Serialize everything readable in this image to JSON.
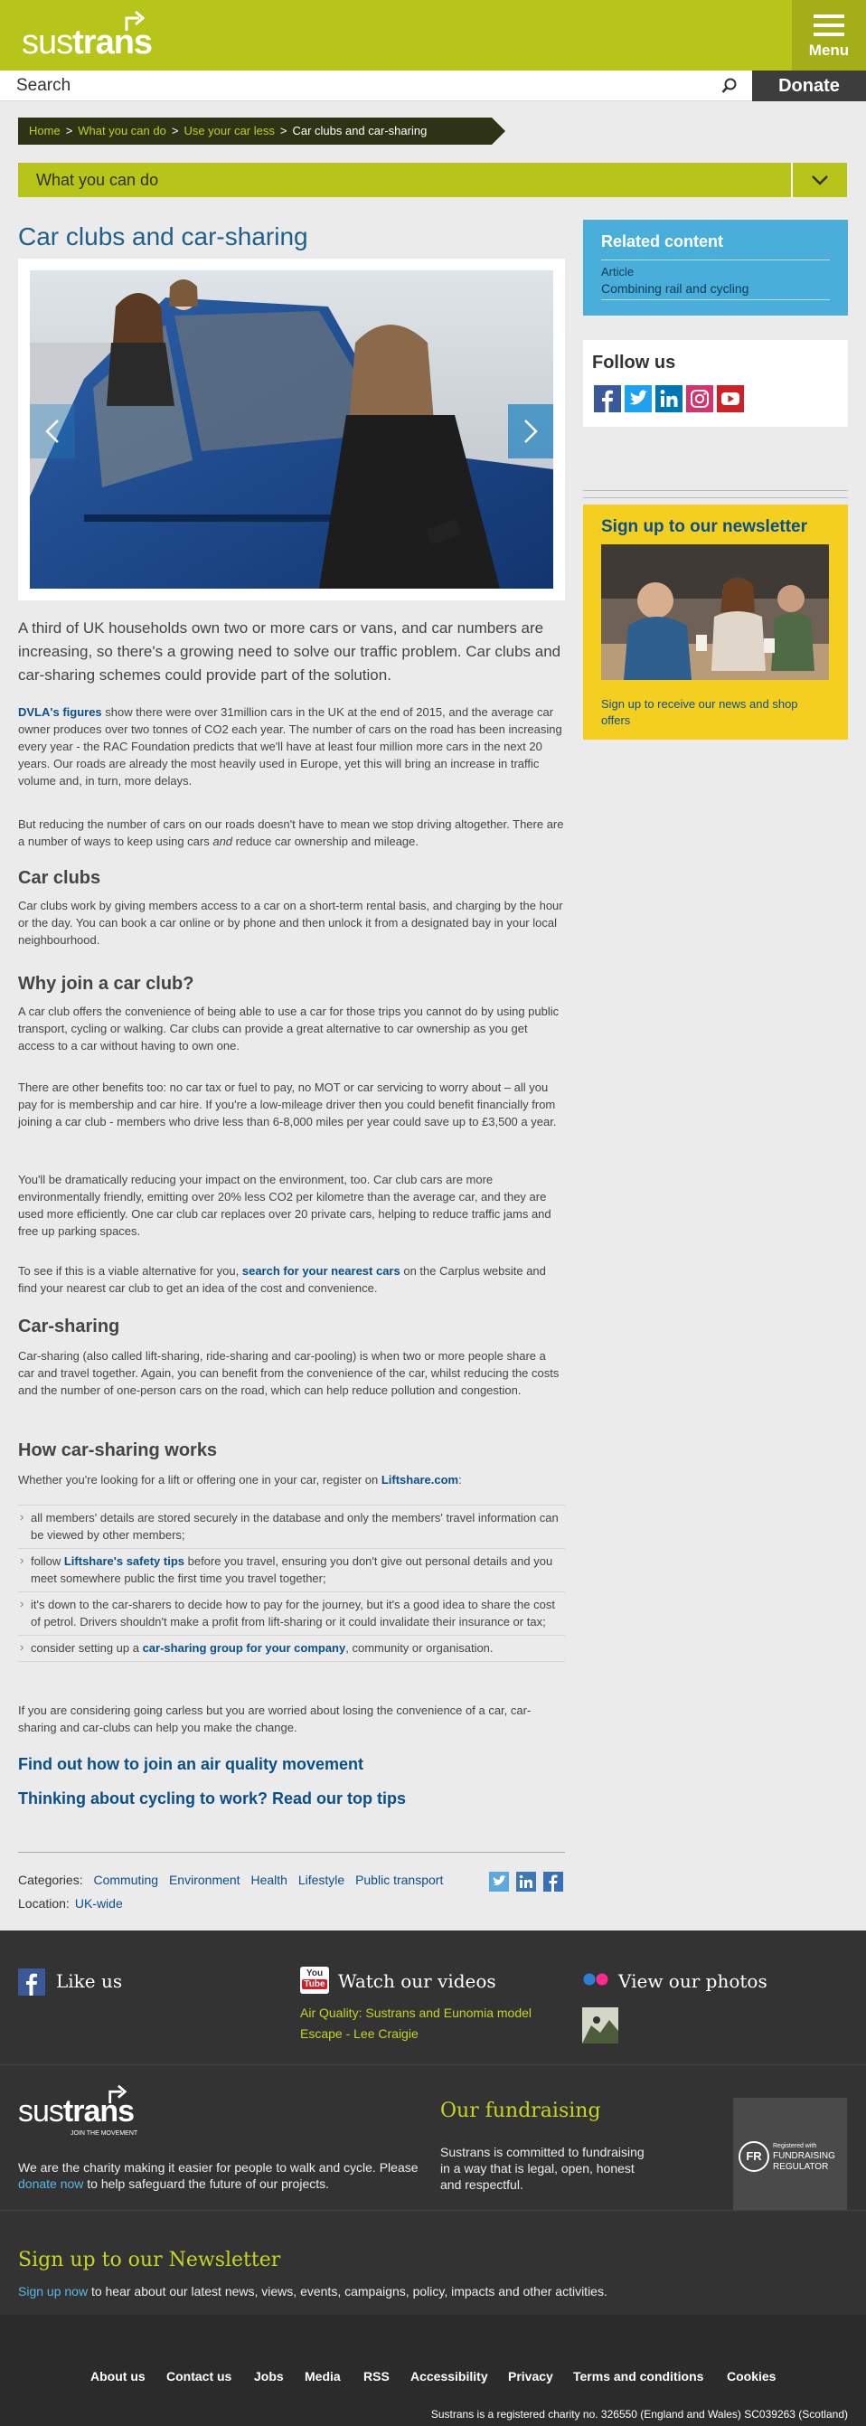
{
  "header": {
    "logo_part1": "sus",
    "logo_part2": "trans",
    "menu_label": "Menu",
    "search_placeholder": "Search",
    "donate_label": "Donate"
  },
  "breadcrumb": {
    "items": [
      "Home",
      "What you can do",
      "Use your car less"
    ],
    "separator": ">",
    "current": "Car clubs and car-sharing"
  },
  "section_nav": {
    "label": "What you can do"
  },
  "article": {
    "title": "Car clubs and car-sharing",
    "lead": "A third of UK households own two or more cars or vans, and car numbers are increasing, so there's a growing need to solve our traffic problem. Car clubs and car-sharing schemes could provide part of the solution.",
    "p1_link": "DVLA's figures",
    "p1_text": " show there were over 31million cars in the UK at the end of 2015, and the average car owner produces over two tonnes of CO2 each year. The number of cars on the road has been increasing every year - the RAC Foundation predicts that we'll have at least four million more cars in the next 20 years. Our roads are already the most heavily used in Europe, yet this will bring an increase in traffic volume and, in turn, more delays.",
    "p2_a": "But reducing the number of cars on our roads doesn't have to mean we stop driving altogether. There are a number of ways to keep using cars ",
    "p2_em": "and",
    "p2_b": " reduce car ownership and mileage.",
    "h_car_clubs": "Car clubs",
    "p3": "Car clubs work by giving members access to a car on a short-term rental basis, and charging by the hour or the day. You can book a car online or by phone and then unlock it from a designated bay in your local neighbourhood.",
    "h_why": "Why join a car club?",
    "p4": "A car club offers the convenience of being able to use a car for those trips you cannot do by using public transport, cycling or walking. Car clubs can provide a great alternative to car ownership as you get access to a car without having to own one.",
    "p5": "There are other benefits too: no car tax or fuel to pay, no MOT or car servicing to worry about – all you pay for is membership and car hire. If you're a low-mileage driver then you could benefit financially from joining a car club - members who drive less than 6-8,000 miles per year could save up to £3,500 a year.",
    "p6": "You'll be dramatically reducing your impact on the environment, too. Car club cars are more environmentally friendly, emitting over 20% less CO2 per kilometre than the average car, and they are used more efficiently. One car club car replaces over 20 private cars, helping to reduce traffic jams and free up parking spaces.",
    "p7_a": "To see if this is a viable alternative for you, ",
    "p7_link": "search for your nearest cars",
    "p7_b": " on the Carplus website and find your nearest car club to get an idea of the cost and convenience.",
    "h_sharing": "Car-sharing",
    "p8": "Car-sharing (also called lift-sharing, ride-sharing and car-pooling) is when two or more people share a car and travel together. Again, you can benefit from the convenience of the car, whilst reducing the costs and the number of one-person cars on the road, which can help reduce pollution and congestion.",
    "h_how": "How car-sharing works",
    "p9_a": "Whether you're looking for a lift or offering one in your car, register on ",
    "p9_link": "Liftshare.com",
    "p9_b": ":",
    "li1": "all members' details are stored securely in the database and only the members' travel information can be viewed by other members;",
    "li2_a": "follow ",
    "li2_link": "Liftshare's safety tips",
    "li2_b": " before you travel, ensuring you don't give out personal details and you meet somewhere public the first time you travel together;",
    "li3": "it's down to the car-sharers to decide how to pay for the journey, but it's a good idea to share the cost of petrol. Drivers shouldn't make a profit from lift-sharing or it could invalidate their insurance or tax;",
    "li4_a": "consider setting up a ",
    "li4_link": "car-sharing group for your company",
    "li4_b": ", community or organisation.",
    "p10": "If you are considering going carless but you are worried about losing the convenience of a car, car-sharing and car-clubs can help you make the change.",
    "cta1": "Find out how to join an air quality movement",
    "cta2": "Thinking about cycling to work? Read our top tips",
    "categories_label": "Categories:",
    "categories": [
      "Commuting",
      "Environment",
      "Health",
      "Lifestyle",
      "Public transport"
    ],
    "location_label": "Location:",
    "location": "UK-wide"
  },
  "sidebar": {
    "related_title": "Related content",
    "related_type": "Article",
    "related_link": "Combining rail and cycling",
    "follow_title": "Follow us",
    "newsletter_title": "Sign up to our newsletter",
    "newsletter_caption": "Sign up to receive our news and shop offers"
  },
  "footer": {
    "like_us": "Like us",
    "watch_videos": "Watch our videos",
    "video1": "Air Quality: Sustrans and Eunomia model",
    "video2": "Escape - Lee Craigie",
    "view_photos": "View our photos",
    "youtube_badge_top": "You",
    "youtube_badge_bottom": "Tube",
    "logo_tagline": "JOIN THE MOVEMENT",
    "charity_a": "We are the charity making it easier for people to walk and cycle. Please ",
    "charity_link": "donate now",
    "charity_b": " to help safeguard the future of our projects.",
    "fundraising_title": "Our fundraising",
    "fundraising_text": "Sustrans is committed to fundraising in a way that is legal, open, honest and respectful.",
    "regulator_small": "Registered with",
    "regulator_big1": "FUNDRAISING",
    "regulator_big2": "REGULATOR",
    "regulator_mark": "FR",
    "newsletter_title": "Sign up to our Newsletter",
    "newsletter_link": "Sign up now",
    "newsletter_text": " to hear about our latest news, views, events, campaigns, policy, impacts and other activities.",
    "links": [
      "About us",
      "Contact us",
      "Jobs",
      "Media",
      "RSS",
      "Accessibility",
      "Privacy",
      "Terms and conditions",
      "Cookies"
    ],
    "registered": "Sustrans is a registered charity no. 326550 (England and Wales) SC039263 (Scotland)"
  },
  "colors": {
    "brand_green": "#b7c41a",
    "link_blue": "#0b4f8a",
    "related_blue": "#49aed9",
    "newsletter_yellow": "#f5cf1f",
    "footer_dark": "#333333"
  },
  "icons": [
    "upward-arrow-logo-icon",
    "hamburger-icon",
    "search-icon",
    "chevron-down-icon",
    "chevron-left-icon",
    "chevron-right-icon",
    "facebook-icon",
    "twitter-icon",
    "linkedin-icon",
    "instagram-icon",
    "youtube-icon",
    "flickr-icon"
  ]
}
